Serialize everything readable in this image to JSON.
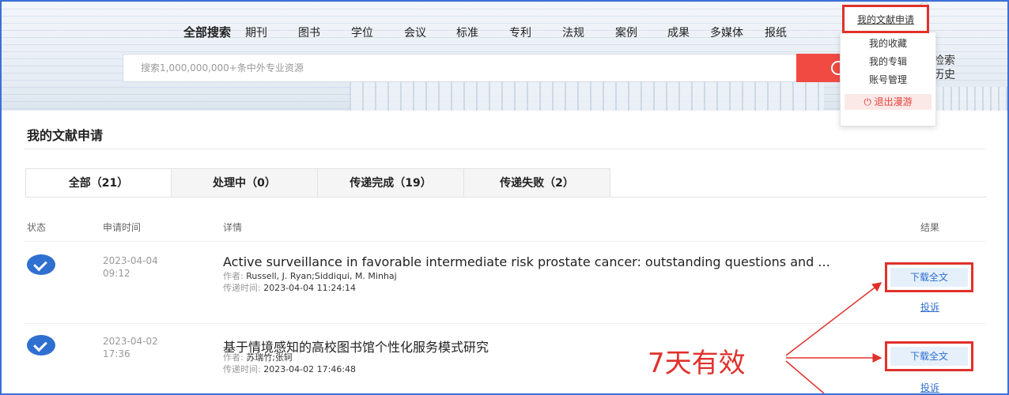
{
  "header": {
    "nav": [
      "全部搜索",
      "期刊",
      "图书",
      "学位",
      "会议",
      "标准",
      "专利",
      "法规",
      "案例",
      "成果",
      "多媒体",
      "报纸"
    ],
    "search_placeholder": "搜索1,000,000,000+条中外专业资源",
    "advanced_line1": "检索",
    "advanced_line2": "历史"
  },
  "user_menu": {
    "items": [
      "我的文献申请",
      "我的收藏",
      "我的专辑",
      "账号管理"
    ],
    "logout": "退出漫游"
  },
  "page": {
    "title": "我的文献申请",
    "tabs": [
      "全部（21）",
      "处理中（0）",
      "传递完成（19）",
      "传递失败（2）"
    ],
    "columns": {
      "status": "状态",
      "time": "申请时间",
      "detail": "详情",
      "result": "结果"
    }
  },
  "records": [
    {
      "date": "2023-04-04",
      "time": "09:12",
      "title": "Active surveillance in favorable intermediate risk prostate cancer: outstanding questions and ...",
      "author_label": "作者:",
      "authors": "Russell, J. Ryan;Siddiqui, M. Minhaj",
      "delivery_label": "传递时间:",
      "delivery_time": "2023-04-04 11:24:14",
      "download": "下载全文",
      "complain": "投诉"
    },
    {
      "date": "2023-04-02",
      "time": "17:36",
      "title": "基于情境感知的高校图书馆个性化服务模式研究",
      "author_label": "作者:",
      "authors": "苏瑞竹;张轲",
      "delivery_label": "传递时间:",
      "delivery_time": "2023-04-02 17:46:48",
      "download": "下载全文",
      "complain": "投诉"
    }
  ],
  "annotation": "7天有效",
  "colors": {
    "accent_red": "#e0312b",
    "link_blue": "#2f6fd0",
    "search_red": "#f04a43"
  }
}
